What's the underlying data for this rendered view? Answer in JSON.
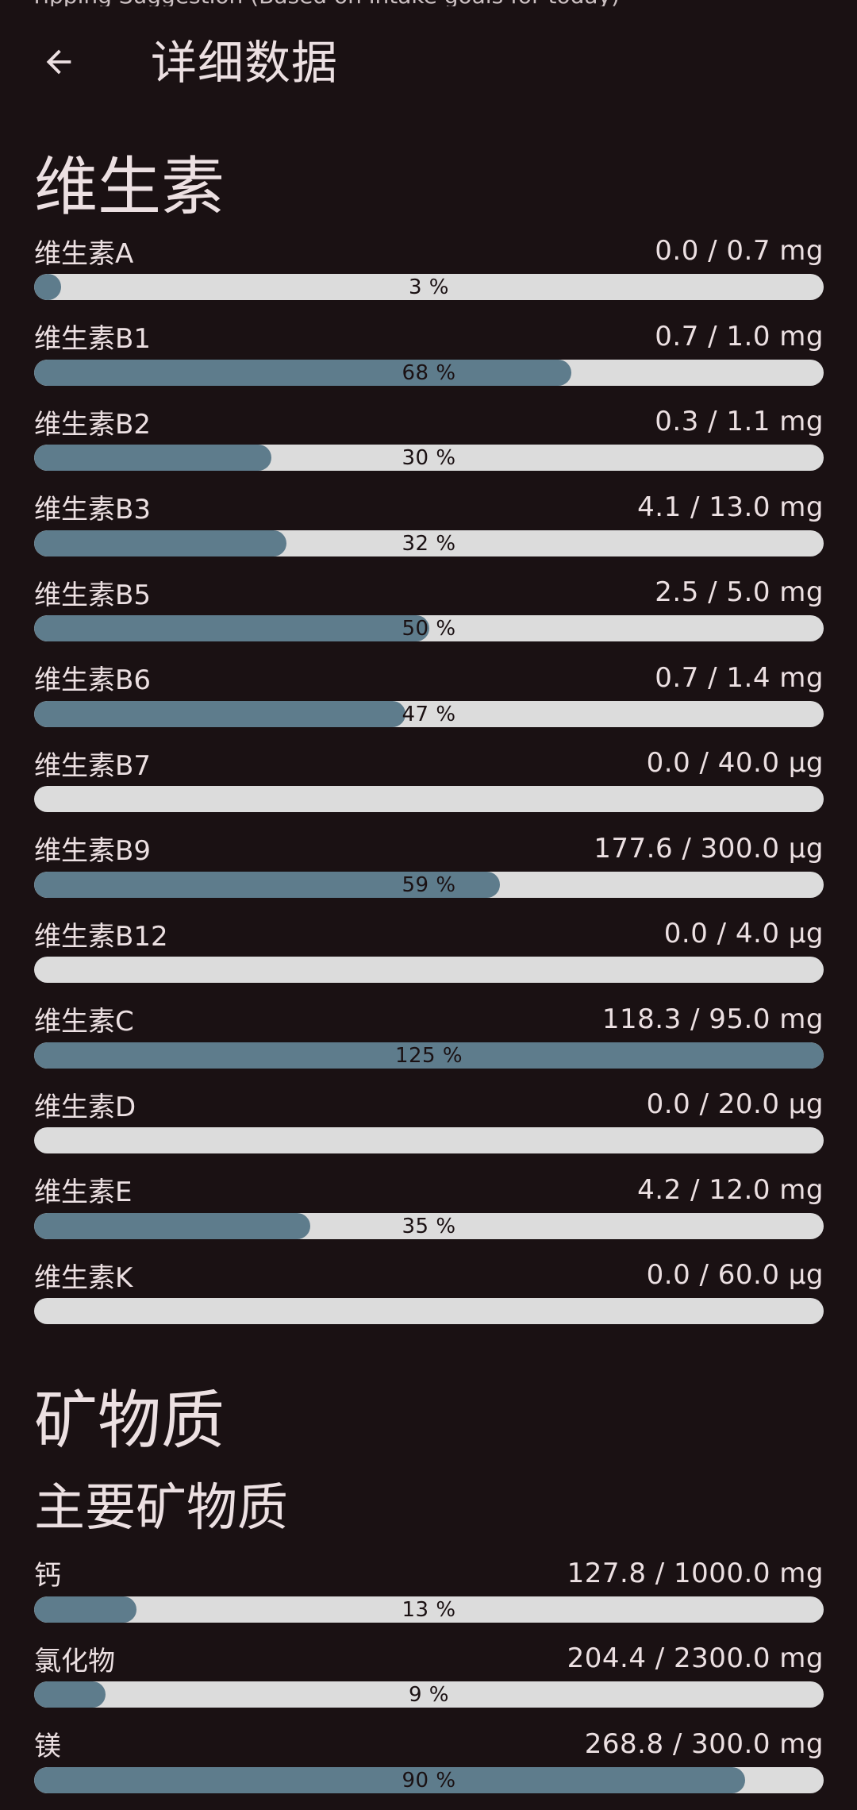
{
  "header": {
    "status_fragment": "Tipping Suggestion (Based on intake goals for today)",
    "title": "详细数据",
    "back_icon": "arrow-back-icon"
  },
  "colors": {
    "background": "#1a1113",
    "text": "#ece0e2",
    "track": "#dcdcdc",
    "fill": "#5e7c8c"
  },
  "vitamins": {
    "title": "维生素",
    "items": [
      {
        "name": "维生素A",
        "value": "0.0 / 0.7 mg",
        "percent": 3,
        "label": "3 %"
      },
      {
        "name": "维生素B1",
        "value": "0.7 / 1.0 mg",
        "percent": 68,
        "label": "68 %"
      },
      {
        "name": "维生素B2",
        "value": "0.3 / 1.1 mg",
        "percent": 30,
        "label": "30 %"
      },
      {
        "name": "维生素B3",
        "value": "4.1 / 13.0 mg",
        "percent": 32,
        "label": "32 %"
      },
      {
        "name": "维生素B5",
        "value": "2.5 / 5.0 mg",
        "percent": 50,
        "label": "50 %"
      },
      {
        "name": "维生素B6",
        "value": "0.7 / 1.4 mg",
        "percent": 47,
        "label": "47 %"
      },
      {
        "name": "维生素B7",
        "value": "0.0 / 40.0 μg",
        "percent": 0,
        "label": ""
      },
      {
        "name": "维生素B9",
        "value": "177.6 / 300.0 μg",
        "percent": 59,
        "label": "59 %"
      },
      {
        "name": "维生素B12",
        "value": "0.0 / 4.0 μg",
        "percent": 0,
        "label": ""
      },
      {
        "name": "维生素C",
        "value": "118.3 / 95.0 mg",
        "percent": 125,
        "label": "125 %"
      },
      {
        "name": "维生素D",
        "value": "0.0 / 20.0 μg",
        "percent": 0,
        "label": ""
      },
      {
        "name": "维生素E",
        "value": "4.2 / 12.0 mg",
        "percent": 35,
        "label": "35 %"
      },
      {
        "name": "维生素K",
        "value": "0.0 / 60.0 μg",
        "percent": 0,
        "label": ""
      }
    ]
  },
  "minerals": {
    "title": "矿物质",
    "major": {
      "title": "主要矿物质",
      "items": [
        {
          "name": "钙",
          "value": "127.8 / 1000.0 mg",
          "percent": 13,
          "label": "13 %"
        },
        {
          "name": "氯化物",
          "value": "204.4 / 2300.0 mg",
          "percent": 9,
          "label": "9 %"
        },
        {
          "name": "镁",
          "value": "268.8 / 300.0 mg",
          "percent": 90,
          "label": "90 %"
        }
      ]
    }
  }
}
